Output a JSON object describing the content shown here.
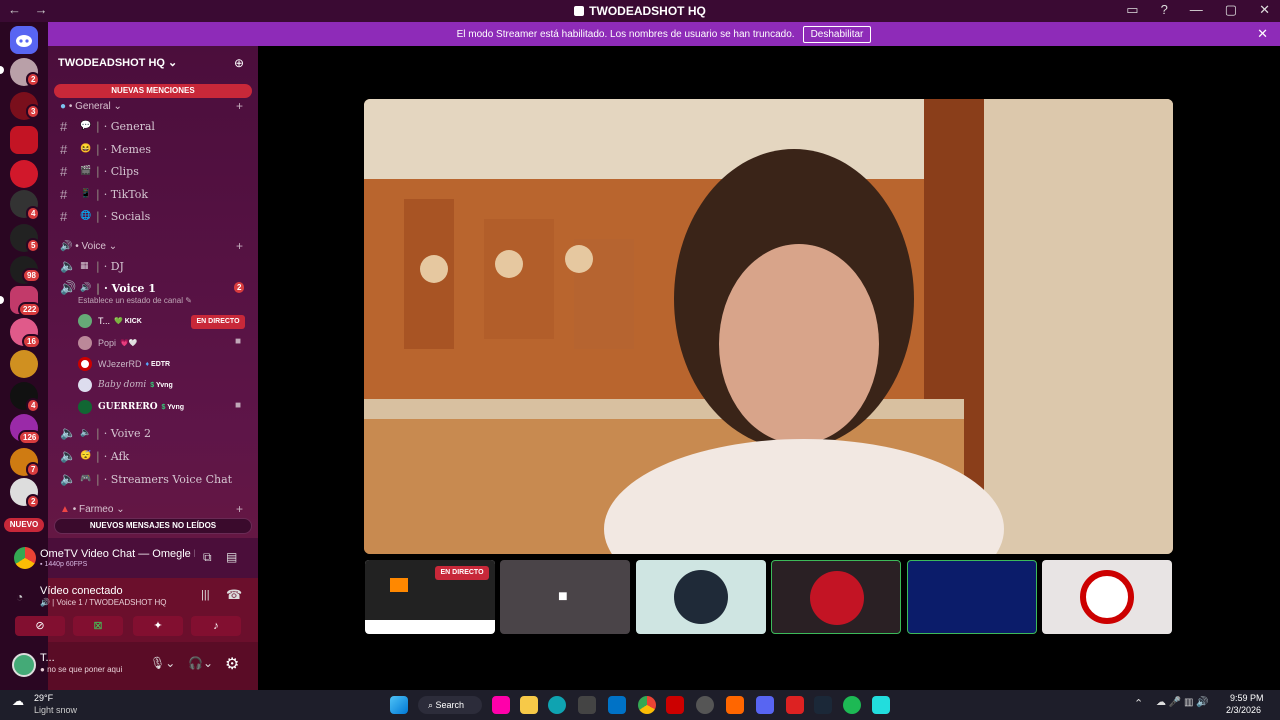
{
  "window": {
    "title": "TWODEADSHOT HQ",
    "nav_back": "←",
    "nav_forward": "→",
    "controls": [
      "▭",
      "?",
      "—",
      "▢",
      "✕"
    ]
  },
  "banner": {
    "text": "El modo Streamer está habilitado. Los nombres de usuario se han truncado.",
    "button": "Deshabilitar",
    "close": "✕"
  },
  "rail": {
    "badges": [
      "2",
      "3",
      "4",
      "5",
      "98",
      "222",
      "16",
      "4",
      "126",
      "7",
      "2"
    ],
    "new_label": "NUEVO"
  },
  "sidebar": {
    "server_name": "TWODEADSHOT HQ",
    "server_chevron": "⌄",
    "mentions_pill": "NUEVAS MENCIONES",
    "categories": {
      "general": "• General",
      "voice": "• Voice",
      "farmeo": "• Farmeo"
    },
    "channels": {
      "general": "· General",
      "memes": "· Memes",
      "clips": "· Clips",
      "tiktok": "· TikTok",
      "socials": "· Socials",
      "dj": "· DJ",
      "voice1": "· Voice 1",
      "voive2": "· Voive 2",
      "afk": "· Afk",
      "streamers": "· Streamers Voice Chat"
    },
    "voice1_count": "2",
    "channel_status": "Establece un estado de canal",
    "users": [
      {
        "name": "T...",
        "tag": "KICK",
        "live": "EN DIRECTO"
      },
      {
        "name": "Popi",
        "tag": ""
      },
      {
        "name": "WJezerRD",
        "tag": "EDTR"
      },
      {
        "name": "Baby domi",
        "tag": "Yvng"
      },
      {
        "name": "GUERRERO",
        "tag": "Yvng"
      }
    ],
    "new_messages_pill": "NUEVOS MENSAJES NO LEÍDOS"
  },
  "activity": {
    "title": "OmeTV Video Chat — Omegle R...",
    "sub": "1440p 60FPS"
  },
  "voice_panel": {
    "status": "Vídeo conectado",
    "channel": "Voice 1 / TWODEADSHOT HQ"
  },
  "user_panel": {
    "name": "T...",
    "status": "no se que poner aqui"
  },
  "main": {
    "live_badge": "EN DIRECTO"
  },
  "taskbar": {
    "weather_temp": "29°F",
    "weather_desc": "Light snow",
    "search": "Search",
    "time": "9:59 PM",
    "date": "2/3/2026"
  },
  "colors": {
    "accent": "#c82839",
    "banner": "#8e2bb8",
    "sidebar": "#4b0e3c"
  }
}
